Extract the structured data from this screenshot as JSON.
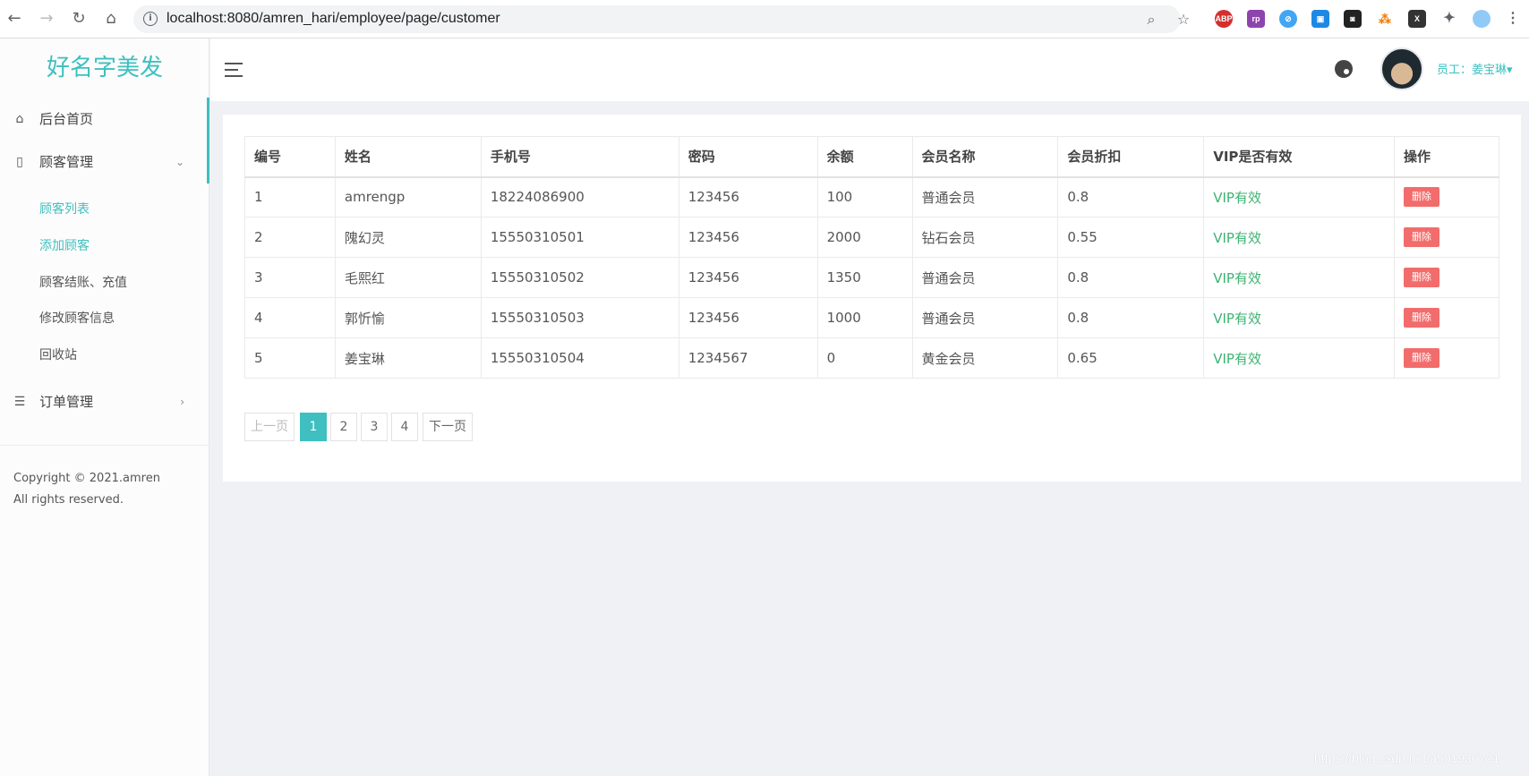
{
  "browser": {
    "url": "localhost:8080/amren_hari/employee/page/customer",
    "extensions": [
      "ABP",
      "rp",
      "⊘",
      "▣",
      "◙",
      "⁂",
      "X"
    ]
  },
  "sidebar": {
    "brand": "好名字美发",
    "menu": [
      {
        "label": "后台首页",
        "icon": "home-icon"
      },
      {
        "label": "顾客管理",
        "icon": "document-icon",
        "expanded": true
      },
      {
        "label": "订单管理",
        "icon": "list-icon",
        "expanded": false
      }
    ],
    "submenu": [
      {
        "label": "顾客列表",
        "highlighted": true
      },
      {
        "label": "添加顾客",
        "highlighted": true
      },
      {
        "label": "顾客结账、充值",
        "highlighted": false
      },
      {
        "label": "修改顾客信息",
        "highlighted": false
      },
      {
        "label": "回收站",
        "highlighted": false
      }
    ],
    "copyright": "Copyright © 2021.amren All rights reserved."
  },
  "header": {
    "user_label": "员工：姜宝琳▾"
  },
  "table": {
    "columns": [
      "编号",
      "姓名",
      "手机号",
      "密码",
      "余额",
      "会员名称",
      "会员折扣",
      "VIP是否有效",
      "操作"
    ],
    "rows": [
      [
        "1",
        "amrengp",
        "18224086900",
        "123456",
        "100",
        "普通会员",
        "0.8",
        "VIP有效",
        "删除"
      ],
      [
        "2",
        "隗幻灵",
        "15550310501",
        "123456",
        "2000",
        "钻石会员",
        "0.55",
        "VIP有效",
        "删除"
      ],
      [
        "3",
        "毛熙红",
        "15550310502",
        "123456",
        "1350",
        "普通会员",
        "0.8",
        "VIP有效",
        "删除"
      ],
      [
        "4",
        "郭忻愉",
        "15550310503",
        "123456",
        "1000",
        "普通会员",
        "0.8",
        "VIP有效",
        "删除"
      ],
      [
        "5",
        "姜宝琳",
        "15550310504",
        "1234567",
        "0",
        "黄金会员",
        "0.65",
        "VIP有效",
        "删除"
      ]
    ]
  },
  "pagination": {
    "prev": "上一页",
    "pages": [
      "1",
      "2",
      "3",
      "4"
    ],
    "current": "1",
    "next": "下一页"
  },
  "watermark": "https://blog.csdn.net/a501936721",
  "colors": {
    "accent": "#3fbfbf",
    "vip": "#3cb371",
    "delete": "#f26c6c"
  }
}
